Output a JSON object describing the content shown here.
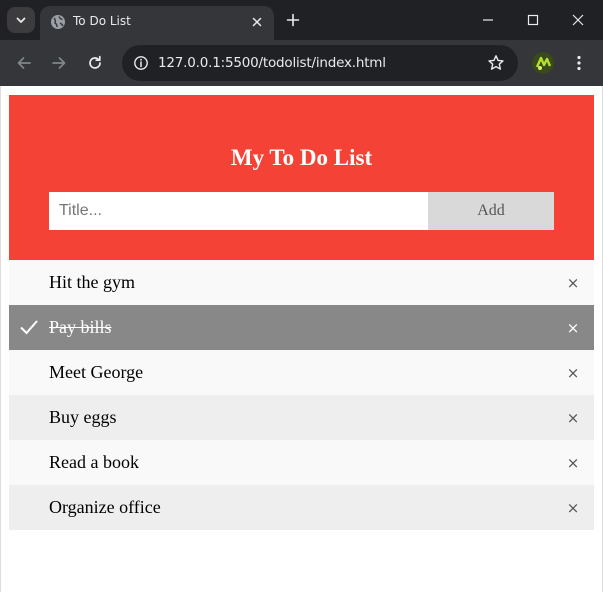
{
  "browser": {
    "tab_title": "To Do List",
    "url": "127.0.0.1:5500/todolist/index.html"
  },
  "icons": {
    "tab_search": "chevron-down-icon",
    "favicon": "globe-icon",
    "tab_close": "close-icon",
    "new_tab": "plus-icon",
    "minimize": "minimize-icon",
    "maximize": "maximize-icon",
    "window_close": "close-icon",
    "back": "arrow-left-icon",
    "forward": "arrow-right-icon",
    "reload": "reload-icon",
    "site_info": "site-info-icon",
    "bookmark": "star-icon",
    "profile": "avatar",
    "menu": "kebab-menu-icon",
    "item_check": "checkmark-icon",
    "item_remove": "close-icon"
  },
  "app": {
    "heading": "My To Do List",
    "input_placeholder": "Title...",
    "input_value": "",
    "add_label": "Add",
    "items": [
      {
        "text": "Hit the gym",
        "checked": false,
        "close": "×"
      },
      {
        "text": "Pay bills",
        "checked": true,
        "close": "×"
      },
      {
        "text": "Meet George",
        "checked": false,
        "close": "×"
      },
      {
        "text": "Buy eggs",
        "checked": false,
        "close": "×"
      },
      {
        "text": "Read a book",
        "checked": false,
        "close": "×"
      },
      {
        "text": "Organize office",
        "checked": false,
        "close": "×"
      }
    ]
  },
  "colors": {
    "header": "#f44336",
    "checked_item": "#888888",
    "row_light": "#f9f9f9",
    "row_dark": "#eeeeee",
    "add_button": "#d9d9d9"
  }
}
